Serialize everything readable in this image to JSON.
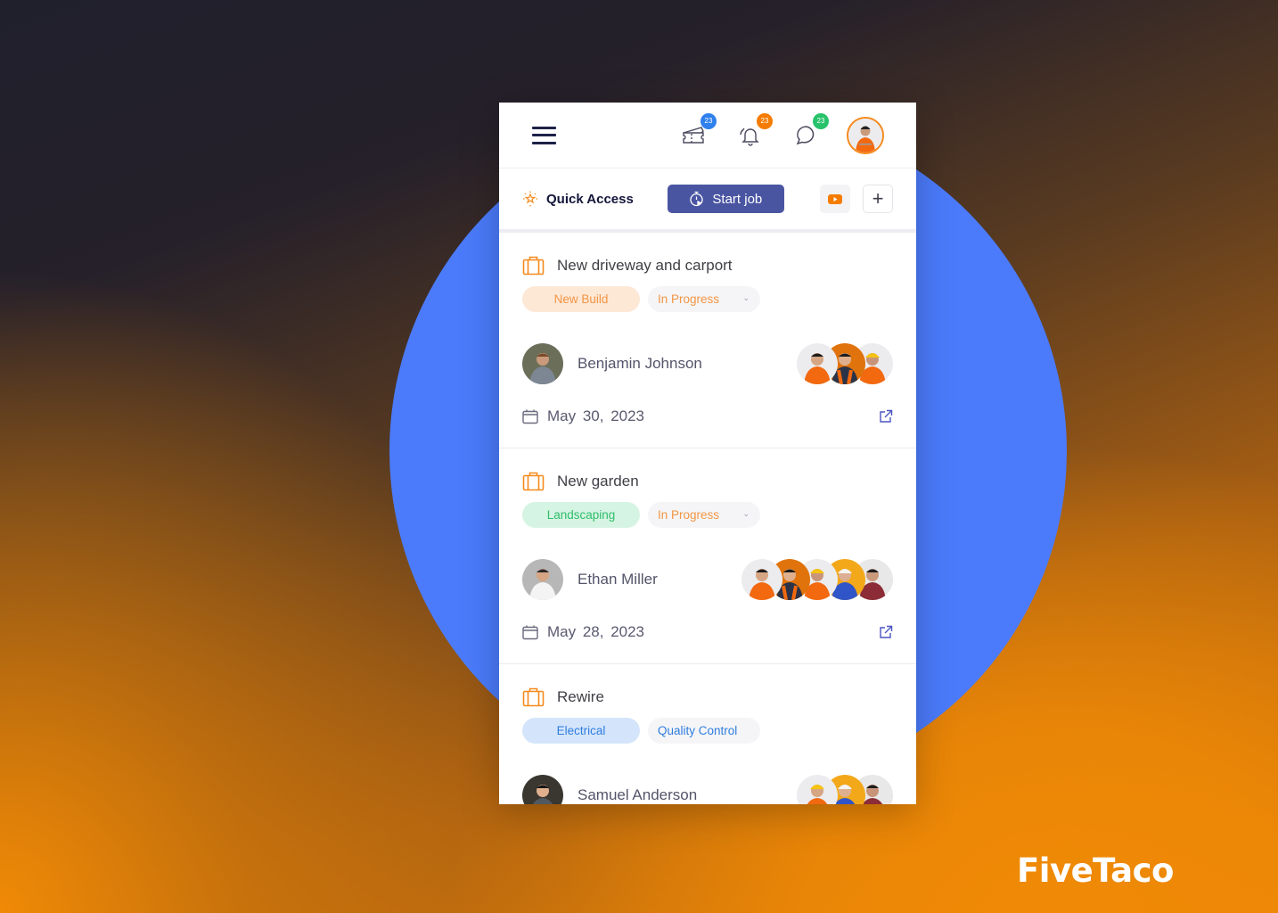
{
  "brand": {
    "name": "FiveTaco"
  },
  "colors": {
    "accent_orange": "#f68a1d",
    "primary_indigo": "#4a55a2",
    "background_blue": "#4b7bfb",
    "badge_blue": "#2f80ed",
    "badge_orange": "#f57c00",
    "badge_green": "#27c26a"
  },
  "header": {
    "menu_icon": "hamburger-icon",
    "icons": [
      {
        "name": "tickets-icon",
        "badge": "23",
        "badge_color": "#2f80ed"
      },
      {
        "name": "bell-icon",
        "badge": "23",
        "badge_color": "#f57c00"
      },
      {
        "name": "chat-icon",
        "badge": "23",
        "badge_color": "#27c26a"
      }
    ],
    "profile_avatar": "user-avatar"
  },
  "quick_access": {
    "label": "Quick Access",
    "start_job_label": "Start job",
    "video_icon": "youtube-icon",
    "add_icon": "plus-icon",
    "add_label": "+"
  },
  "jobs": [
    {
      "title": "New driveway and carport",
      "category": {
        "label": "New Build",
        "bg": "#fde8d6",
        "color": "#f39544"
      },
      "status": {
        "label": "In Progress",
        "color": "#f39544",
        "has_dropdown": true
      },
      "owner": "Benjamin Johnson",
      "team_count": 3,
      "date_month": "May",
      "date_rest": "30, 2023"
    },
    {
      "title": "New garden",
      "category": {
        "label": "Landscaping",
        "bg": "#d6f4e3",
        "color": "#2ebd6a"
      },
      "status": {
        "label": "In Progress",
        "color": "#f39544",
        "has_dropdown": true
      },
      "owner": "Ethan Miller",
      "team_count": 5,
      "date_month": "May",
      "date_rest": "28, 2023"
    },
    {
      "title": "Rewire",
      "category": {
        "label": "Electrical",
        "bg": "#d4e5fb",
        "color": "#2f7de0"
      },
      "status": {
        "label": "Quality Control",
        "color": "#2f7de0",
        "has_dropdown": false
      },
      "owner": "Samuel Anderson",
      "team_count": 3
    }
  ]
}
